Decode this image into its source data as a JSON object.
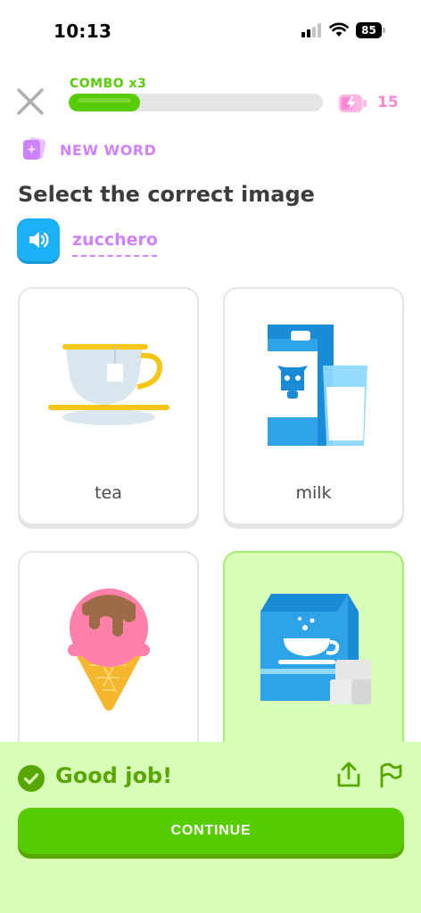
{
  "status_bar": {
    "time": "10:13",
    "battery": "85"
  },
  "progress": {
    "combo_label": "COMBO x3",
    "fraction": 0.28,
    "energy_count": "15"
  },
  "challenge": {
    "tag": "NEW WORD",
    "prompt": "Select the correct image",
    "word": "zucchero"
  },
  "options": [
    {
      "label": "tea",
      "icon": "teacup-icon"
    },
    {
      "label": "milk",
      "icon": "milk-carton-icon"
    },
    {
      "label": "",
      "icon": "ice-cream-icon"
    },
    {
      "label": "",
      "icon": "sugar-bag-icon",
      "selected": true
    }
  ],
  "feedback": {
    "message": "Good job!",
    "continue_label": "CONTINUE"
  },
  "colors": {
    "brand_green": "#58cc02",
    "feedback_bg": "#d7ffb8",
    "word_purple": "#ce82ff",
    "speaker_blue": "#1cb0f6",
    "energy_pink": "#ff86d0"
  }
}
